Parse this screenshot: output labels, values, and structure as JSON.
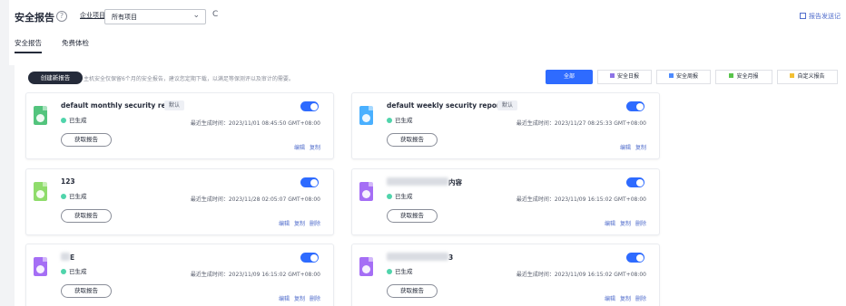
{
  "header": {
    "title": "安全报告",
    "help_icon": "?",
    "project_label": "企业项目",
    "project_value": "所有项目",
    "refresh_icon": "C",
    "email_link": "报告发送记"
  },
  "tabs": [
    "安全报告",
    "免费体检"
  ],
  "toolbar": {
    "create_label": "创建新报告",
    "hint": "主机安全仅保留6个月的安全报告，建议您定期下载，以满足等保测评以及审计的需要。",
    "filters": [
      {
        "label": "全部",
        "color": ""
      },
      {
        "label": "安全日报",
        "color": "#8d73e6"
      },
      {
        "label": "安全周报",
        "color": "#4d8bff"
      },
      {
        "label": "安全月报",
        "color": "#59c44b"
      },
      {
        "label": "自定义报告",
        "color": "#f3c034"
      }
    ]
  },
  "cards": [
    {
      "name": "default monthly security re...",
      "default_badge": "默认",
      "status": "已生成",
      "time": "最近生成时间：2023/11/01 08:45:50 GMT+08:00",
      "button": "获取报告",
      "actions": [
        "编辑",
        "复制"
      ],
      "icon_color": "#53c47d"
    },
    {
      "name": "default weekly security report",
      "default_badge": "默认",
      "status": "已生成",
      "time": "最近生成时间：2023/11/27 08:25:33 GMT+08:00",
      "button": "获取报告",
      "actions": [
        "编辑",
        "复制"
      ],
      "icon_color": "#4ab0ff"
    },
    {
      "name": "123",
      "default_badge": "",
      "status": "已生成",
      "time": "最近生成时间：2023/11/28 02:05:07 GMT+08:00",
      "button": "获取报告",
      "actions": [
        "编辑",
        "复制",
        "删除"
      ],
      "icon_color": "#8fdc6b"
    },
    {
      "name": "内容",
      "default_badge": "",
      "status": "已生成",
      "time": "最近生成时间：2023/11/09 16:15:02 GMT+08:00",
      "button": "获取报告",
      "actions": [
        "编辑",
        "复制",
        "删除"
      ],
      "icon_color": "#a56ef5"
    },
    {
      "name": "E",
      "default_badge": "",
      "status": "已生成",
      "time": "最近生成时间：2023/11/09 16:15:02 GMT+08:00",
      "button": "获取报告",
      "actions": [
        "编辑",
        "复制",
        "删除"
      ],
      "icon_color": "#a56ef5"
    },
    {
      "name": "3",
      "default_badge": "",
      "status": "已生成",
      "time": "最近生成时间：2023/11/09 16:15:02 GMT+08:00",
      "button": "获取报告",
      "actions": [
        "编辑",
        "复制",
        "删除"
      ],
      "icon_color": "#a56ef5"
    }
  ]
}
